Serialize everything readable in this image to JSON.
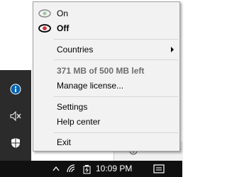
{
  "menu": {
    "items": [
      {
        "label": "On",
        "icon": "eye-icon-inactive"
      },
      {
        "label": "Off",
        "icon": "eye-icon-active"
      },
      {
        "label": "Countries",
        "has_submenu": true
      },
      {
        "label": "371 MB of 500 MB left",
        "disabled": true
      },
      {
        "label": "Manage license..."
      },
      {
        "label": "Settings"
      },
      {
        "label": "Help center"
      },
      {
        "label": "Exit"
      }
    ]
  },
  "tray": {
    "icons": [
      "info-icon",
      "speaker-muted-icon",
      "shield-icon"
    ]
  },
  "taskbar": {
    "clock": "10:09 PM",
    "icons": [
      "chevron-up-icon",
      "wifi-icon",
      "battery-icon",
      "notification-icon"
    ]
  },
  "colors": {
    "tray_bg": "#2b2b2b",
    "taskbar_bg": "#101010",
    "menu_bg": "#f2f2f2",
    "info_blue": "#0063b1"
  }
}
